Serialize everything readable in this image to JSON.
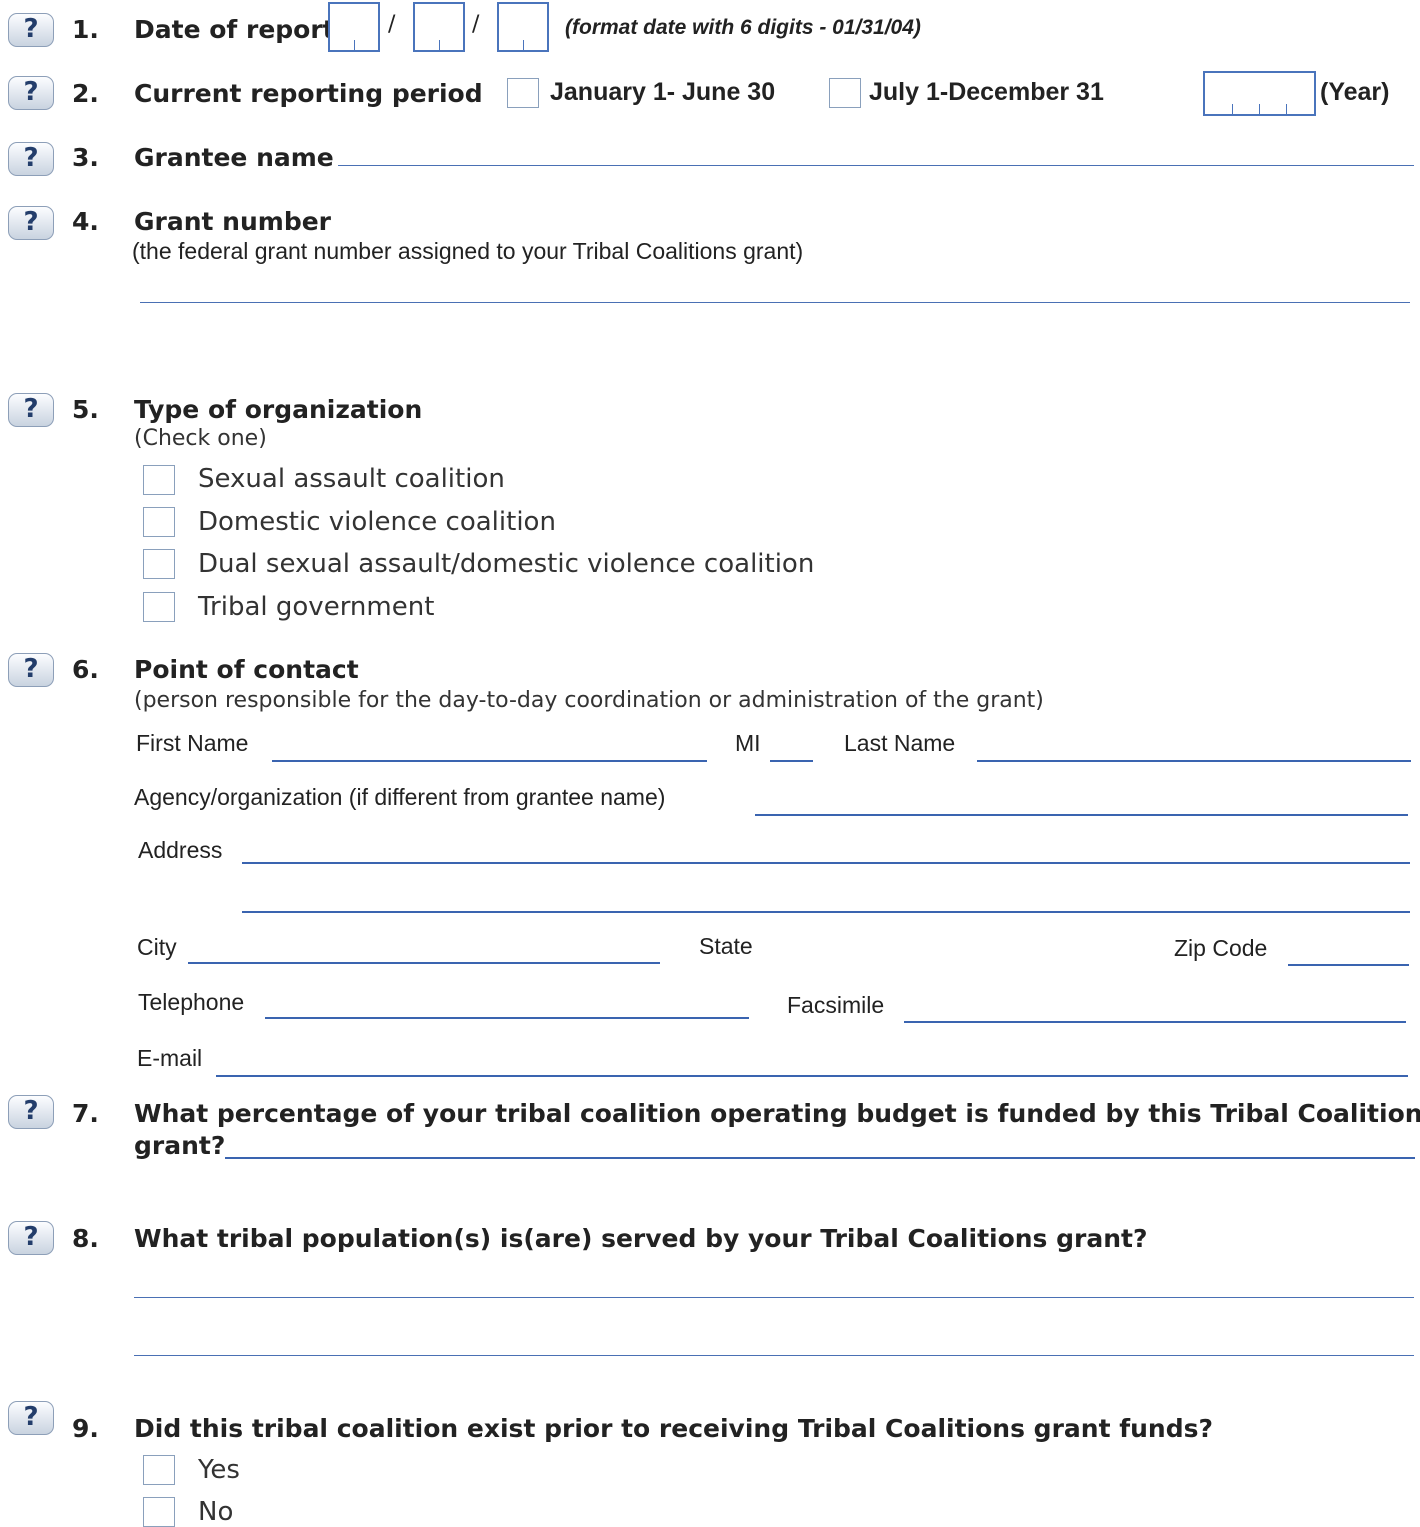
{
  "help_icon": {
    "glyph": "?",
    "icon": "question-mark-icon"
  },
  "colors": {
    "line": "#3a64b0",
    "box_border": "#4a74bc",
    "checkbox_border": "#8aa0bc",
    "help_text": "#233d6b"
  },
  "q1": {
    "number": "1.",
    "label": "Date of report",
    "slash": "/",
    "note": "(format date with 6 digits - 01/31/04)"
  },
  "q2": {
    "number": "2.",
    "label": "Current reporting period",
    "option1": "January 1- June 30",
    "option2": "July 1-December 31",
    "year_label": "(Year)"
  },
  "q3": {
    "number": "3.",
    "label": "Grantee name"
  },
  "q4": {
    "number": "4.",
    "label": "Grant number",
    "sublabel": "(the federal grant number assigned to your Tribal Coalitions grant)"
  },
  "q5": {
    "number": "5.",
    "label": "Type of organization",
    "sublabel": "(Check one)",
    "options": [
      "Sexual assault coalition",
      "Domestic violence coalition",
      "Dual sexual assault/domestic violence coalition",
      "Tribal government"
    ]
  },
  "q6": {
    "number": "6.",
    "label": "Point of contact",
    "sublabel": "(person responsible for the day-to-day coordination or administration of the grant)",
    "first_name": "First Name",
    "mi": "MI",
    "last_name": "Last Name",
    "agency": "Agency/organization (if different from grantee name)",
    "address": "Address",
    "city": "City",
    "state": "State",
    "zip": "Zip Code",
    "telephone": "Telephone",
    "facsimile": "Facsimile",
    "email": "E-mail"
  },
  "q7": {
    "number": "7.",
    "label_line1": "What percentage of your tribal coalition operating budget is funded by this Tribal Coalitions",
    "label_line2": "grant?"
  },
  "q8": {
    "number": "8.",
    "label": "What tribal population(s) is(are) served by your Tribal Coalitions grant?"
  },
  "q9": {
    "number": "9.",
    "label": "Did this tribal coalition exist prior to receiving Tribal Coalitions grant funds?",
    "options": [
      "Yes",
      "No"
    ]
  }
}
